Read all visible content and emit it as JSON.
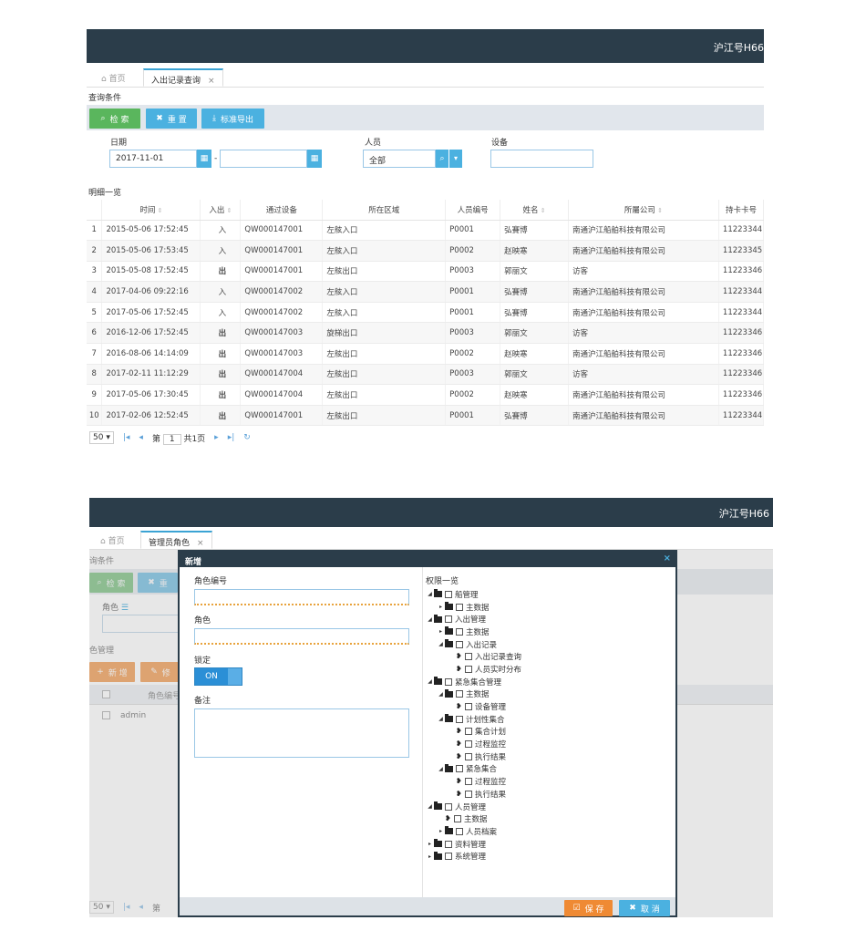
{
  "screen1": {
    "brand": "沪江号H66",
    "tabs": {
      "home": "首页",
      "active": "入出记录查询"
    },
    "query_title": "查询条件",
    "buttons": {
      "search": "检 索",
      "reset": "重 置",
      "export": "标准导出"
    },
    "filters": {
      "date_label": "日期",
      "date_from": "2017-11-01",
      "date_to": "",
      "date_sep": "-",
      "person_label": "人员",
      "person_value": "全部",
      "device_label": "设备",
      "device_value": ""
    },
    "list_title": "明细一览",
    "columns": [
      "时间",
      "入出",
      "通过设备",
      "所在区域",
      "人员编号",
      "姓名",
      "所屬公司",
      "持卡卡号"
    ],
    "rows": [
      {
        "n": "1",
        "time": "2015-05-06 17:52:45",
        "io": "入",
        "dev": "QW000147001",
        "area": "左舷入口",
        "pid": "P0001",
        "name": "弘賽博",
        "company": "南通沪江船舶科技有限公司",
        "card": "11223344"
      },
      {
        "n": "2",
        "time": "2015-05-06 17:53:45",
        "io": "入",
        "dev": "QW000147001",
        "area": "左舷入口",
        "pid": "P0002",
        "name": "赵映寒",
        "company": "南通沪江船舶科技有限公司",
        "card": "11223345"
      },
      {
        "n": "3",
        "time": "2015-05-08 17:52:45",
        "io": "出",
        "dev": "QW000147001",
        "area": "左舷出口",
        "pid": "P0003",
        "name": "郭丽文",
        "company": "访客",
        "card": "11223346"
      },
      {
        "n": "4",
        "time": "2017-04-06 09:22:16",
        "io": "入",
        "dev": "QW000147002",
        "area": "左舷入口",
        "pid": "P0001",
        "name": "弘賽博",
        "company": "南通沪江船舶科技有限公司",
        "card": "11223344"
      },
      {
        "n": "5",
        "time": "2017-05-06 17:52:45",
        "io": "入",
        "dev": "QW000147002",
        "area": "左舷入口",
        "pid": "P0001",
        "name": "弘賽博",
        "company": "南通沪江船舶科技有限公司",
        "card": "11223344"
      },
      {
        "n": "6",
        "time": "2016-12-06 17:52:45",
        "io": "出",
        "dev": "QW000147003",
        "area": "旋梯出口",
        "pid": "P0003",
        "name": "郭丽文",
        "company": "访客",
        "card": "11223346"
      },
      {
        "n": "7",
        "time": "2016-08-06 14:14:09",
        "io": "出",
        "dev": "QW000147003",
        "area": "左舷出口",
        "pid": "P0002",
        "name": "赵映寒",
        "company": "南通沪江船舶科技有限公司",
        "card": "11223346"
      },
      {
        "n": "8",
        "time": "2017-02-11 11:12:29",
        "io": "出",
        "dev": "QW000147004",
        "area": "左舷出口",
        "pid": "P0003",
        "name": "郭丽文",
        "company": "访客",
        "card": "11223346"
      },
      {
        "n": "9",
        "time": "2017-05-06 17:30:45",
        "io": "出",
        "dev": "QW000147004",
        "area": "左舷出口",
        "pid": "P0002",
        "name": "赵映寒",
        "company": "南通沪江船舶科技有限公司",
        "card": "11223346"
      },
      {
        "n": "10",
        "time": "2017-02-06 12:52:45",
        "io": "出",
        "dev": "QW000147001",
        "area": "左舷出口",
        "pid": "P0001",
        "name": "弘賽博",
        "company": "南通沪江船舶科技有限公司",
        "card": "11223344"
      }
    ],
    "pager": {
      "size": "50",
      "page_prefix": "第",
      "page": "1",
      "total": "共1页"
    }
  },
  "screen2": {
    "brand": "沪江号H66",
    "tabs": {
      "home": "首页",
      "active": "管理员角色"
    },
    "bg": {
      "query_title": "询条件",
      "search": "检 索",
      "reset": "重",
      "role_label": "角色",
      "list_title": "色管理",
      "add": "新 增",
      "edit": "修",
      "col_role": "角色编号",
      "row_user": "admin",
      "pager_size": "50",
      "pager_page": "第"
    },
    "modal": {
      "title": "新增",
      "role_no_label": "角色编号",
      "role_label": "角色",
      "lock_label": "锁定",
      "toggle_on": "ON",
      "remark_label": "备注",
      "perm_title": "权限一览",
      "save": "保 存",
      "cancel": "取 消",
      "tree": [
        {
          "level": 0,
          "exp": "open",
          "type": "folder",
          "label": "船管理"
        },
        {
          "level": 1,
          "exp": "closed",
          "type": "folder",
          "label": "主数据"
        },
        {
          "level": 0,
          "exp": "open",
          "type": "folder",
          "label": "入出管理"
        },
        {
          "level": 1,
          "exp": "closed",
          "type": "folder",
          "label": "主数据"
        },
        {
          "level": 1,
          "exp": "open",
          "type": "folder",
          "label": "入出记录"
        },
        {
          "level": 2,
          "exp": "none",
          "type": "leaf",
          "label": "入出记录查询"
        },
        {
          "level": 2,
          "exp": "none",
          "type": "leaf",
          "label": "人员实时分布"
        },
        {
          "level": 0,
          "exp": "open",
          "type": "folder",
          "label": "紧急集合管理"
        },
        {
          "level": 1,
          "exp": "open",
          "type": "folder",
          "label": "主数据"
        },
        {
          "level": 2,
          "exp": "none",
          "type": "leaf",
          "label": "设备管理"
        },
        {
          "level": 1,
          "exp": "open",
          "type": "folder",
          "label": "计划性集合"
        },
        {
          "level": 2,
          "exp": "none",
          "type": "leaf",
          "label": "集合计划"
        },
        {
          "level": 2,
          "exp": "none",
          "type": "leaf",
          "label": "过程监控"
        },
        {
          "level": 2,
          "exp": "none",
          "type": "leaf",
          "label": "执行结果"
        },
        {
          "level": 1,
          "exp": "open",
          "type": "folder",
          "label": "紧急集合"
        },
        {
          "level": 2,
          "exp": "none",
          "type": "leaf",
          "label": "过程监控"
        },
        {
          "level": 2,
          "exp": "none",
          "type": "leaf",
          "label": "执行结果"
        },
        {
          "level": 0,
          "exp": "open",
          "type": "folder",
          "label": "人员管理"
        },
        {
          "level": 1,
          "exp": "none",
          "type": "leaf",
          "label": "主数据"
        },
        {
          "level": 1,
          "exp": "closed",
          "type": "folder",
          "label": "人员档案"
        },
        {
          "level": 0,
          "exp": "closed",
          "type": "folder",
          "label": "资料管理"
        },
        {
          "level": 0,
          "exp": "closed",
          "type": "folder",
          "label": "系统管理"
        }
      ]
    }
  },
  "colors": {
    "header": "#2b3d4a",
    "green": "#5ab65d",
    "blue": "#4bb1e0",
    "orange": "#ef8a34"
  }
}
